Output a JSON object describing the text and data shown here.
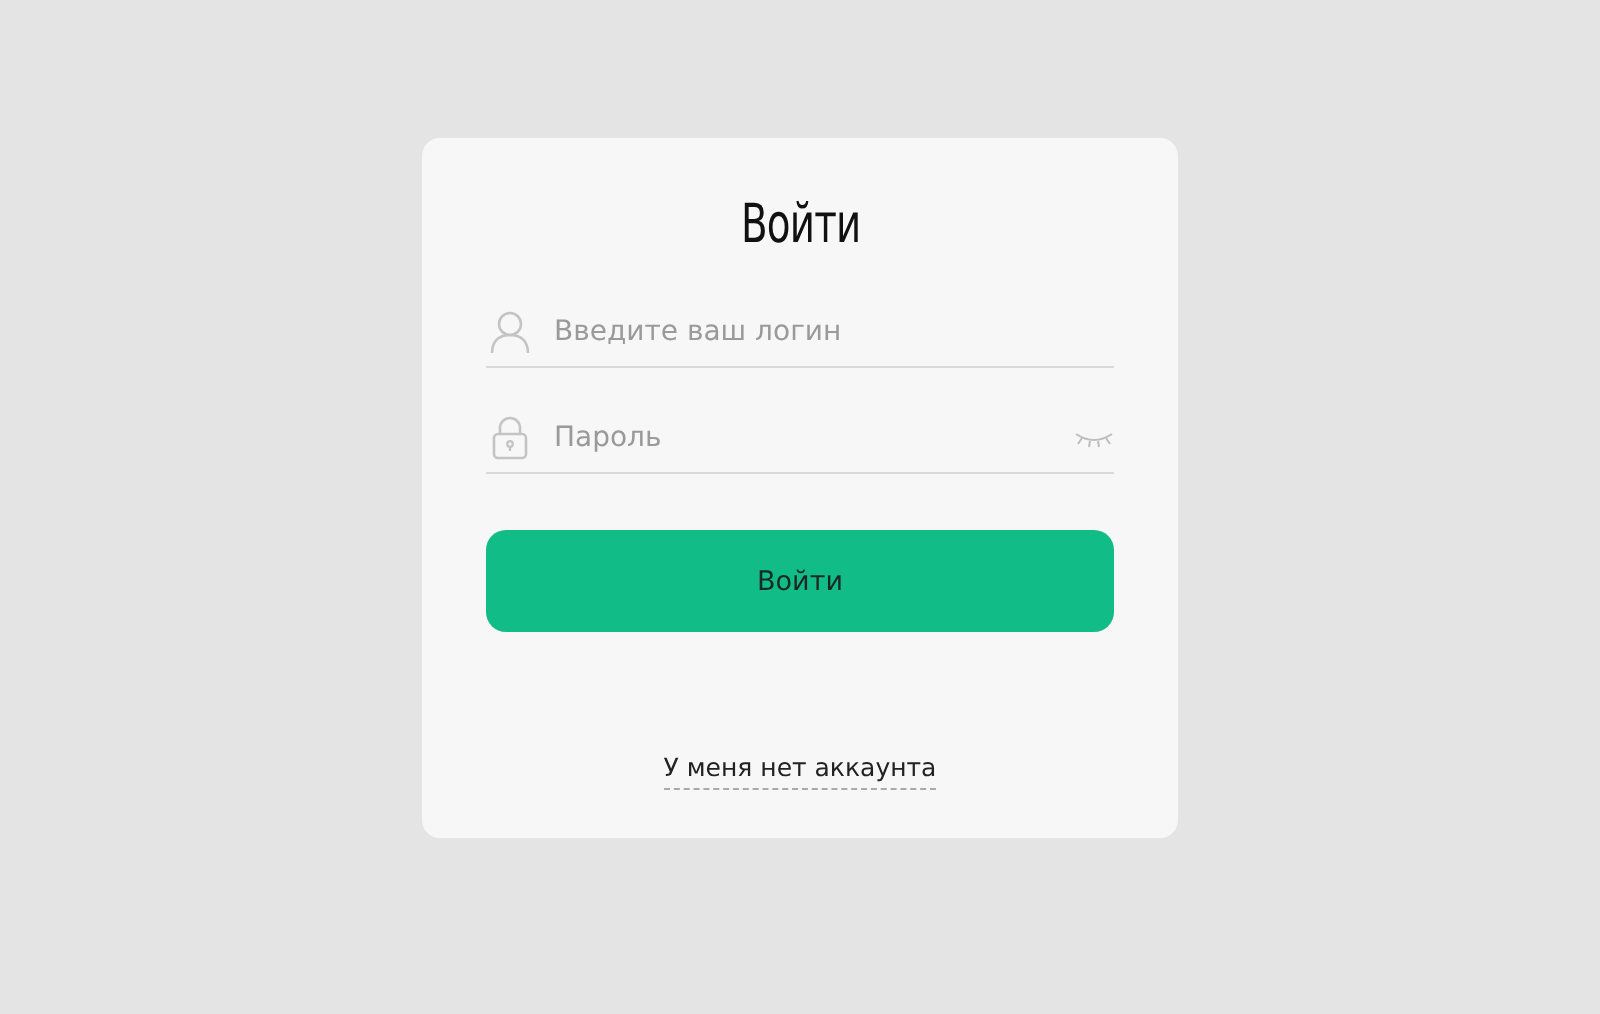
{
  "title": "Войти",
  "fields": [
    {
      "kind": "login",
      "placeholder": "Введите ваш логин"
    },
    {
      "kind": "password",
      "placeholder": "Пароль"
    }
  ],
  "submit_button": "Войти",
  "register_link": "У меня нет аккаунта"
}
